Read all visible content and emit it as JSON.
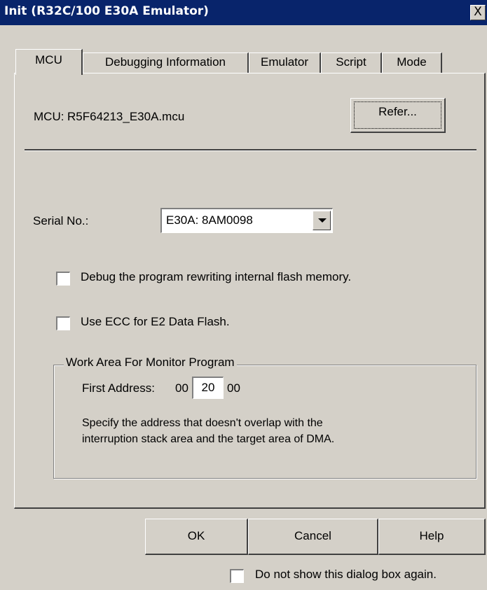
{
  "window": {
    "title": "Init (R32C/100 E30A Emulator)",
    "close_glyph": "X"
  },
  "tabs": [
    {
      "label": "MCU"
    },
    {
      "label": "Debugging Information"
    },
    {
      "label": "Emulator"
    },
    {
      "label": "Script"
    },
    {
      "label": "Mode"
    }
  ],
  "mcu": {
    "label": "MCU:",
    "file": "R5F64213_E30A.mcu",
    "refer_label": "Refer..."
  },
  "serial": {
    "label": "Serial No.:",
    "value": "E30A: 8AM0098"
  },
  "options": {
    "debug_flash_label": "Debug the program rewriting internal flash memory.",
    "debug_flash_checked": false,
    "ecc_label": "Use ECC for E2 Data Flash.",
    "ecc_checked": false
  },
  "work_area": {
    "title": "Work Area For Monitor Program",
    "first_address_label": "First Address:",
    "prefix": "00",
    "value": "20",
    "suffix": "00",
    "description_line1": "Specify the address that doesn't overlap with the",
    "description_line2": "interruption stack area and the target area of DMA."
  },
  "buttons": {
    "ok": "OK",
    "cancel": "Cancel",
    "help": "Help"
  },
  "footer": {
    "dont_show_label": "Do not show this dialog box again.",
    "dont_show_checked": false
  }
}
